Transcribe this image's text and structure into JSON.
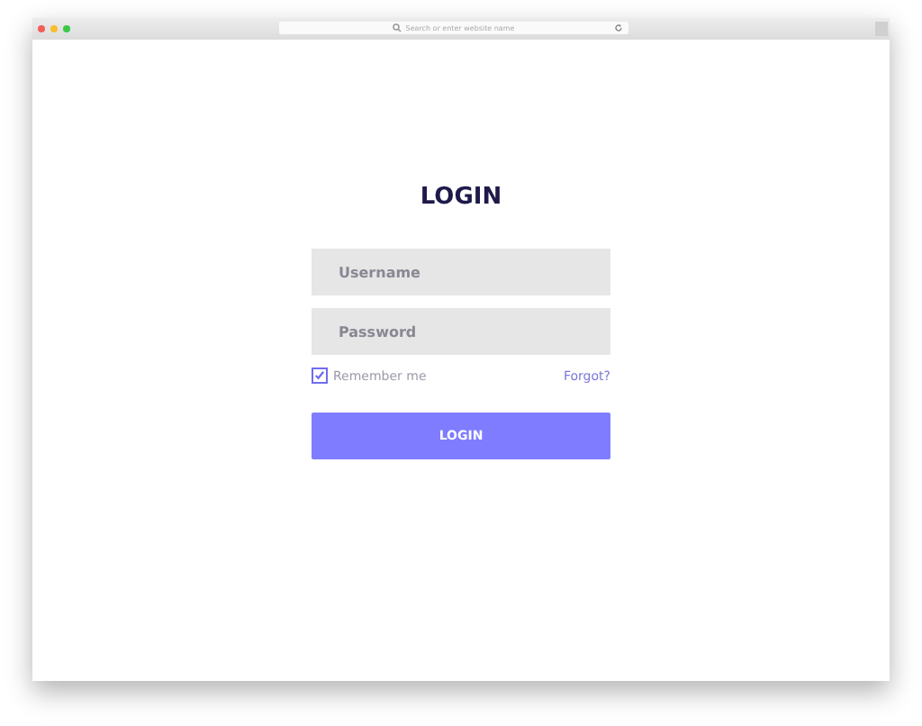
{
  "browser": {
    "address_placeholder": "Search or enter website name"
  },
  "login": {
    "title": "LOGIN",
    "username": {
      "placeholder": "Username"
    },
    "password": {
      "placeholder": "Password"
    },
    "remember": {
      "label": "Remember me",
      "checked": true
    },
    "forgot": "Forgot?",
    "button": "LOGIN"
  }
}
